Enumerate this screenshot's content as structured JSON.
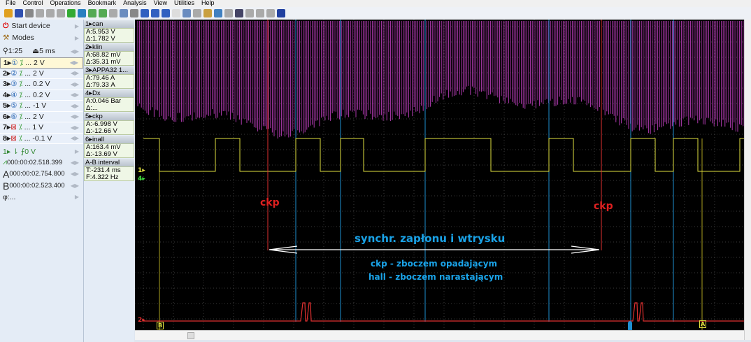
{
  "menu": [
    "File",
    "Control",
    "Operations",
    "Bookmark",
    "Analysis",
    "View",
    "Utilities",
    "Help"
  ],
  "left": {
    "start_device": "Start device",
    "modes": "Modes",
    "zoom": "1:25",
    "timebase": "5 ms",
    "channels": [
      {
        "n": "1▸",
        "num": "①",
        "range": "... 2 V"
      },
      {
        "n": "2▸",
        "num": "②",
        "range": "... 2 V"
      },
      {
        "n": "3▸",
        "num": "③",
        "range": "... 0.2 V"
      },
      {
        "n": "4▸",
        "num": "④",
        "range": "... 0.2 V"
      },
      {
        "n": "5▸",
        "num": "⑤",
        "range": "... -1 V"
      },
      {
        "n": "6▸",
        "num": "⑥",
        "range": "... 2 V"
      },
      {
        "n": "7▸",
        "num": "⊠",
        "range": "... 1 V"
      },
      {
        "n": "8▸",
        "num": "⊠",
        "range": "... -0.1 V"
      }
    ],
    "trigger": "1▸ ⇂ ⨍0 V",
    "trigger_time": "000:00:02.518.399",
    "a_time": "000:00:02.754.800",
    "b_time": "000:00:02.523.400",
    "phi": "φ:..."
  },
  "measurements": [
    {
      "name": "1▸can",
      "a": "A:5.953 V",
      "d": "Δ:1.782 V"
    },
    {
      "name": "2▸klin",
      "a": "A:68.82 mV",
      "d": "Δ:35.31 mV"
    },
    {
      "name": "3▸APPA32 1...",
      "a": "A:79.46 A",
      "d": "Δ:79.33 A"
    },
    {
      "name": "4▸Dx",
      "a": "A:0.046 Bar",
      "d": "Δ:..."
    },
    {
      "name": "5▸ckp",
      "a": "A:-6.998 V",
      "d": "Δ:-12.66 V"
    },
    {
      "name": "6▸inall",
      "a": "A:163.4 mV",
      "d": "Δ:-13.69 V"
    },
    {
      "name": "A-B interval",
      "a": "T:-231.4 ms",
      "d": "F:4.322 Hz"
    }
  ],
  "plot": {
    "ch1_label": "1▸",
    "ch4_label": "4▸",
    "ch2_label": "2▸",
    "ckp_left": "ckp",
    "ckp_right": "ckp",
    "sync": "synchr. zapłonu i wtrysku",
    "note1": "ckp - zboczem opadającym",
    "note2": "hall - zboczem narastającym",
    "cursor_a": "A",
    "cursor_b": "B",
    "colors": {
      "ch1": "#e0e040",
      "ch2": "#e03030",
      "purple": "#c040c0",
      "blue": "#1e8fd0",
      "text": "#1aa3e8"
    }
  }
}
